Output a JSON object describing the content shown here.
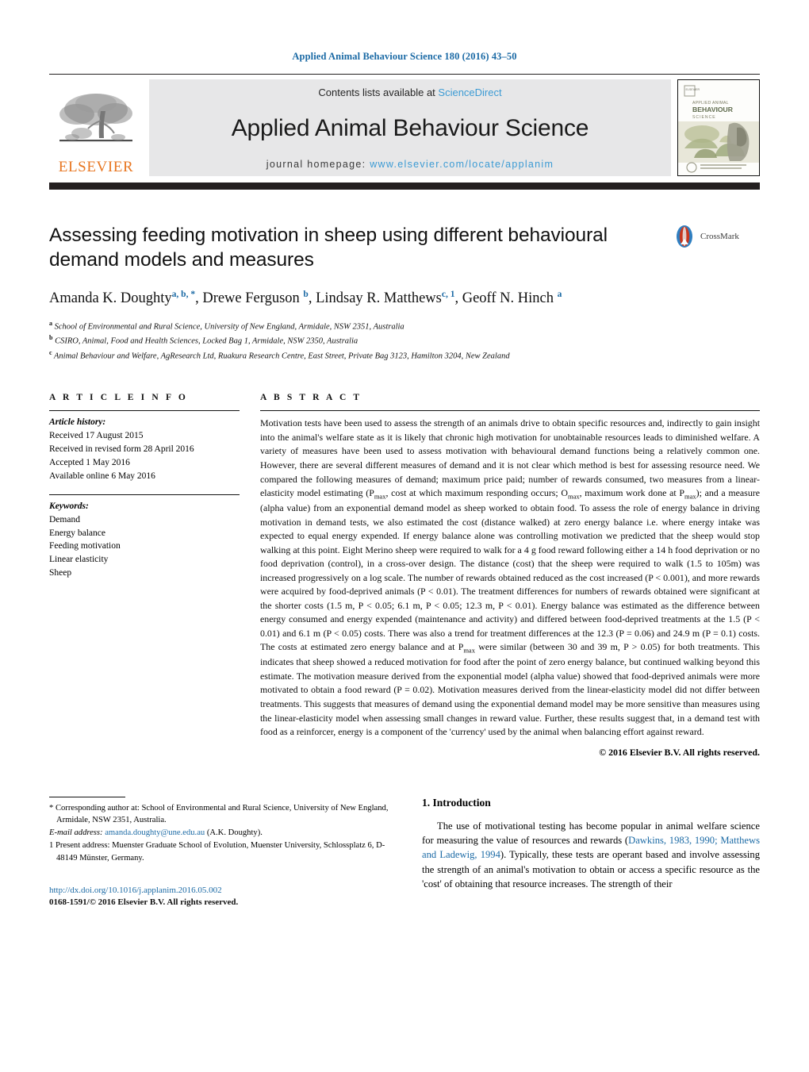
{
  "running_head": "Applied Animal Behaviour Science 180 (2016) 43–50",
  "masthead": {
    "contents_prefix": "Contents lists available at ",
    "sciencedirect": "ScienceDirect",
    "journal_name": "Applied Animal Behaviour Science",
    "homepage_label": "journal homepage:",
    "homepage_url": "www.elsevier.com/locate/applanim",
    "publisher_wordmark": "ELSEVIER",
    "cover_title_top": "APPLIED ANIMAL",
    "cover_title_main": "BEHAVIOUR",
    "cover_title_sub": "SCIENCE",
    "colors": {
      "link_blue": "#3c9bd4",
      "elsevier_orange": "#e87722",
      "band_grey": "#e7e7e8",
      "rule_black": "#231f20"
    }
  },
  "title": "Assessing feeding motivation in sheep using different behavioural demand models and measures",
  "crossmark_label": "CrossMark",
  "authors": [
    {
      "name": "Amanda K. Doughty",
      "sup": "a, b, *"
    },
    {
      "name": "Drewe Ferguson",
      "sup": "b"
    },
    {
      "name": "Lindsay R. Matthews",
      "sup": "c, 1"
    },
    {
      "name": "Geoff N. Hinch",
      "sup": "a"
    }
  ],
  "affiliations": [
    {
      "marker": "a",
      "text": "School of Environmental and Rural Science, University of New England, Armidale, NSW 2351, Australia"
    },
    {
      "marker": "b",
      "text": "CSIRO, Animal, Food and Health Sciences, Locked Bag 1, Armidale, NSW 2350, Australia"
    },
    {
      "marker": "c",
      "text": "Animal Behaviour and Welfare, AgResearch Ltd, Ruakura Research Centre, East Street, Private Bag 3123, Hamilton 3204, New Zealand"
    }
  ],
  "article_info": {
    "heading": "A R T I C L E   I N F O",
    "history_label": "Article history:",
    "history": [
      "Received 17 August 2015",
      "Received in revised form 28 April 2016",
      "Accepted 1 May 2016",
      "Available online 6 May 2016"
    ],
    "keywords_label": "Keywords:",
    "keywords": [
      "Demand",
      "Energy balance",
      "Feeding motivation",
      "Linear elasticity",
      "Sheep"
    ]
  },
  "abstract": {
    "heading": "A B S T R A C T",
    "part1": "Motivation tests have been used to assess the strength of an animals drive to obtain specific resources and, indirectly to gain insight into the animal's welfare state as it is likely that chronic high motivation for unobtainable resources leads to diminished welfare. A variety of measures have been used to assess motivation with behavioural demand functions being a relatively common one. However, there are several different measures of demand and it is not clear which method is best for assessing resource need. We compared the following measures of demand; maximum price paid; number of rewards consumed, two measures from a linear-elasticity model estimating (P",
    "sub1": "max",
    "part2": ", cost at which maximum responding occurs; O",
    "sub2": "max",
    "part3": ", maximum work done at P",
    "sub3": "max",
    "part4": "); and a measure (alpha value) from an exponential demand model as sheep worked to obtain food. To assess the role of energy balance in driving motivation in demand tests, we also estimated the cost (distance walked) at zero energy balance i.e. where energy intake was expected to equal energy expended. If energy balance alone was controlling motivation we predicted that the sheep would stop walking at this point. Eight Merino sheep were required to walk for a 4 g food reward following either a 14 h food deprivation or no food deprivation (control), in a cross-over design. The distance (cost) that the sheep were required to walk (1.5 to 105m) was increased progressively on a log scale. The number of rewards obtained reduced as the cost increased (P < 0.001), and more rewards were acquired by food-deprived animals (P < 0.01). The treatment differences for numbers of rewards obtained were significant at the shorter costs (1.5 m, P < 0.05; 6.1 m, P < 0.05; 12.3 m, P < 0.01). Energy balance was estimated as the difference between energy consumed and energy expended (maintenance and activity) and differed between food-deprived treatments at the 1.5 (P < 0.01) and 6.1 m (P < 0.05) costs. There was also a trend for treatment differences at the 12.3 (P = 0.06) and 24.9 m (P = 0.1) costs. The costs at estimated zero energy balance and at P",
    "sub4": "max",
    "part5": " were similar (between 30 and 39 m, P > 0.05) for both treatments. This indicates that sheep showed a reduced motivation for food after the point of zero energy balance, but continued walking beyond this estimate. The motivation measure derived from the exponential model (alpha value) showed that food-deprived animals were more motivated to obtain a food reward (P = 0.02). Motivation measures derived from the linear-elasticity model did not differ between treatments. This suggests that measures of demand using the exponential demand model may be more sensitive than measures using the linear-elasticity model when assessing small changes in reward value. Further, these results suggest that, in a demand test with food as a reinforcer, energy is a component of the 'currency' used by the animal when balancing effort against reward.",
    "copyright": "© 2016 Elsevier B.V. All rights reserved."
  },
  "introduction": {
    "heading": "1.  Introduction",
    "par1_a": "The use of motivational testing has become popular in animal welfare science for measuring the value of resources and rewards (",
    "par1_cite": "Dawkins, 1983, 1990; Matthews and Ladewig, 1994",
    "par1_b": "). Typically, these tests are operant based and involve assessing the strength of an animal's motivation to obtain or access a specific resource as the 'cost' of obtaining that resource increases. The strength of their"
  },
  "footnotes": {
    "corresponding": "* Corresponding author at: School of Environmental and Rural Science, University of New England, Armidale, NSW 2351, Australia.",
    "email_label": "E-mail address:",
    "email": "amanda.doughty@une.edu.au",
    "email_suffix": "(A.K. Doughty).",
    "present_address": "1  Present address: Muenster Graduate School of Evolution, Muenster University, Schlossplatz 6, D-48149 Münster, Germany."
  },
  "footer": {
    "doi": "http://dx.doi.org/10.1016/j.applanim.2016.05.002",
    "issn": "0168-1591/© 2016 Elsevier B.V. All rights reserved."
  }
}
